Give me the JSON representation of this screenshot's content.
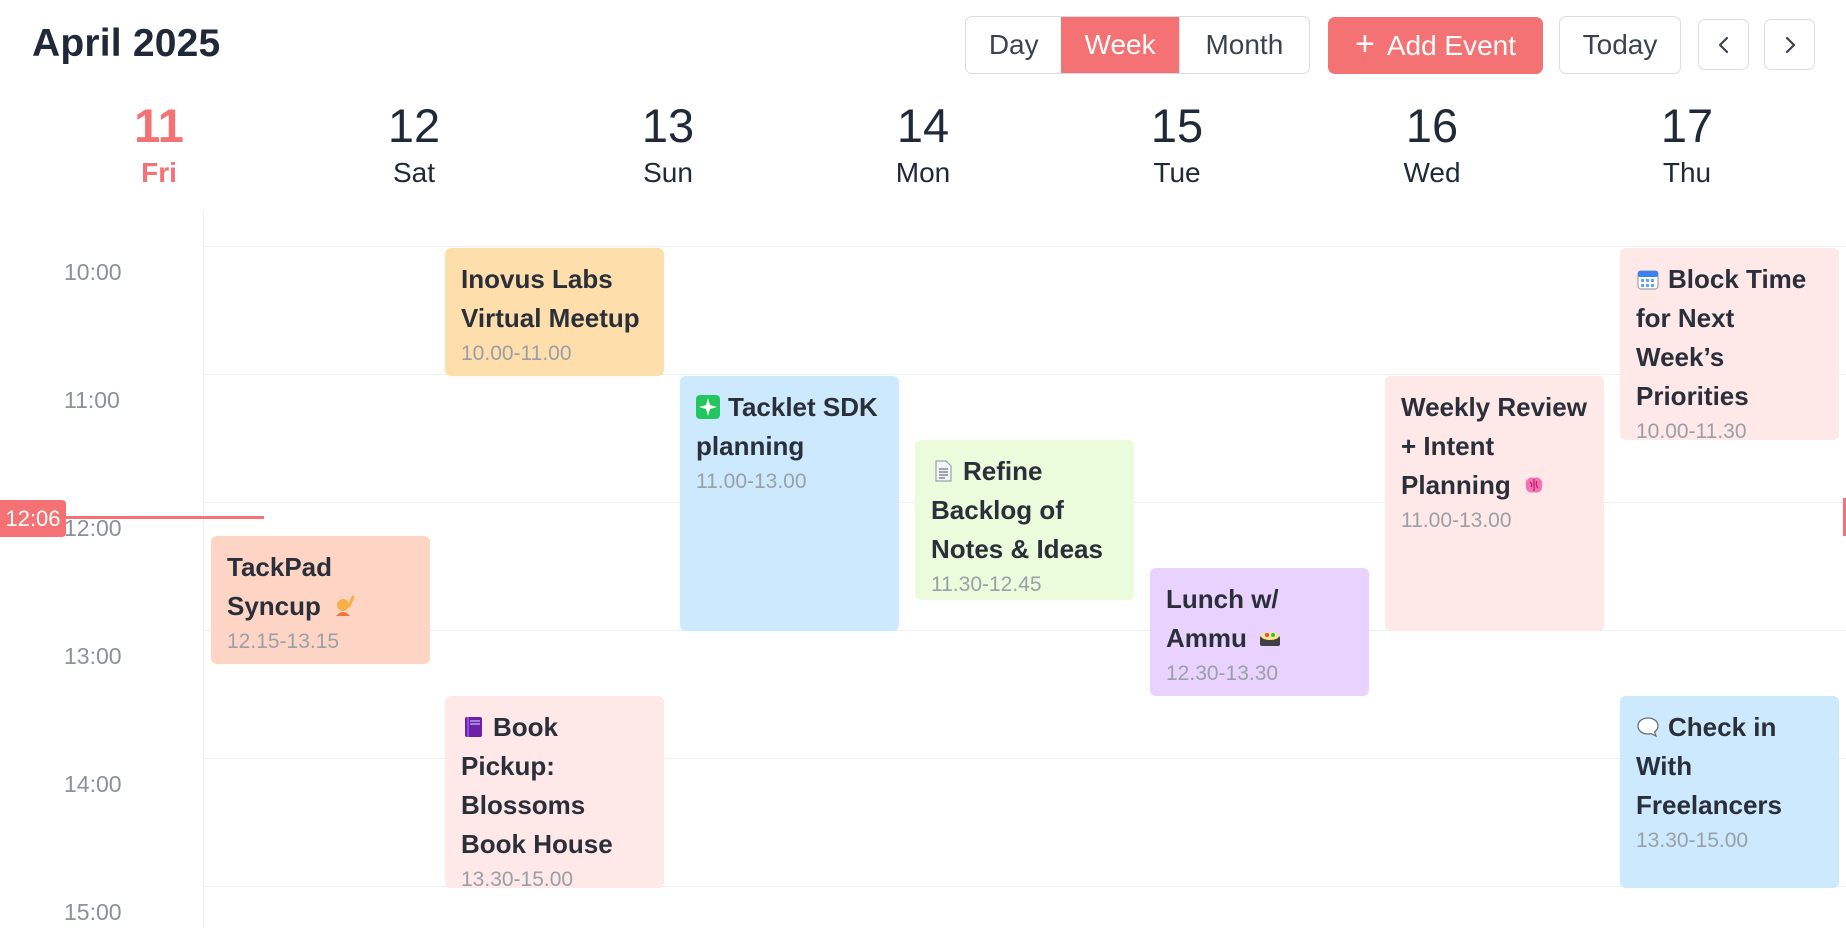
{
  "header": {
    "title": "April 2025",
    "views": [
      "Day",
      "Week",
      "Month"
    ],
    "active_view": "Week",
    "add_event_label": "Add Event",
    "today_label": "Today"
  },
  "colors": {
    "accent": "#f47274",
    "orange": "#fedfab",
    "salmon": "#fed4c5",
    "blue": "#cde9fd",
    "green": "#eafcdc",
    "purple": "#e9d3fe",
    "pink": "#fee8e8"
  },
  "days": [
    {
      "num": "11",
      "name": "Fri",
      "today": true
    },
    {
      "num": "12",
      "name": "Sat"
    },
    {
      "num": "13",
      "name": "Sun"
    },
    {
      "num": "14",
      "name": "Mon"
    },
    {
      "num": "15",
      "name": "Tue"
    },
    {
      "num": "16",
      "name": "Wed"
    },
    {
      "num": "17",
      "name": "Thu"
    }
  ],
  "hours": [
    "10:00",
    "11:00",
    "12:00",
    "13:00",
    "14:00",
    "15:00"
  ],
  "now_time": "12:06",
  "events": [
    {
      "title": "Inovus Labs Virtual Meetup",
      "time": "10.00-11.00",
      "day": "Sat",
      "color": "orange"
    },
    {
      "title": "TackPad Syncup",
      "time": "12.15-13.15",
      "day": "Fri",
      "color": "salmon",
      "icon": "raising-hand-emoji"
    },
    {
      "title": "Tacklet SDK planning",
      "time": "11.00-13.00",
      "day": "Sun",
      "color": "blue",
      "icon": "sparkles-emoji"
    },
    {
      "title": "Refine Backlog of Notes & Ideas",
      "time": "11.30-12.45",
      "day": "Mon",
      "color": "green",
      "icon": "page-emoji"
    },
    {
      "title": "Lunch w/ Ammu",
      "time": "12.30-13.30",
      "day": "Tue",
      "color": "purple",
      "icon": "bento-emoji"
    },
    {
      "title": "Weekly Review + Intent Planning",
      "time": "11.00-13.00",
      "day": "Wed",
      "color": "pink",
      "icon": "brain-emoji"
    },
    {
      "title": "Block Time for Next Week’s Priorities",
      "time": "10.00-11.30",
      "day": "Thu",
      "color": "pink",
      "icon": "calendar-emoji"
    },
    {
      "title": "Book Pickup: Blossoms Book House",
      "time": "13.30-15.00",
      "day": "Sat",
      "color": "pink",
      "icon": "notebook-emoji"
    },
    {
      "title": "Check in With Freelancers",
      "time": "13.30-15.00",
      "day": "Thu",
      "color": "blue",
      "icon": "speech-bubble-emoji"
    }
  ]
}
